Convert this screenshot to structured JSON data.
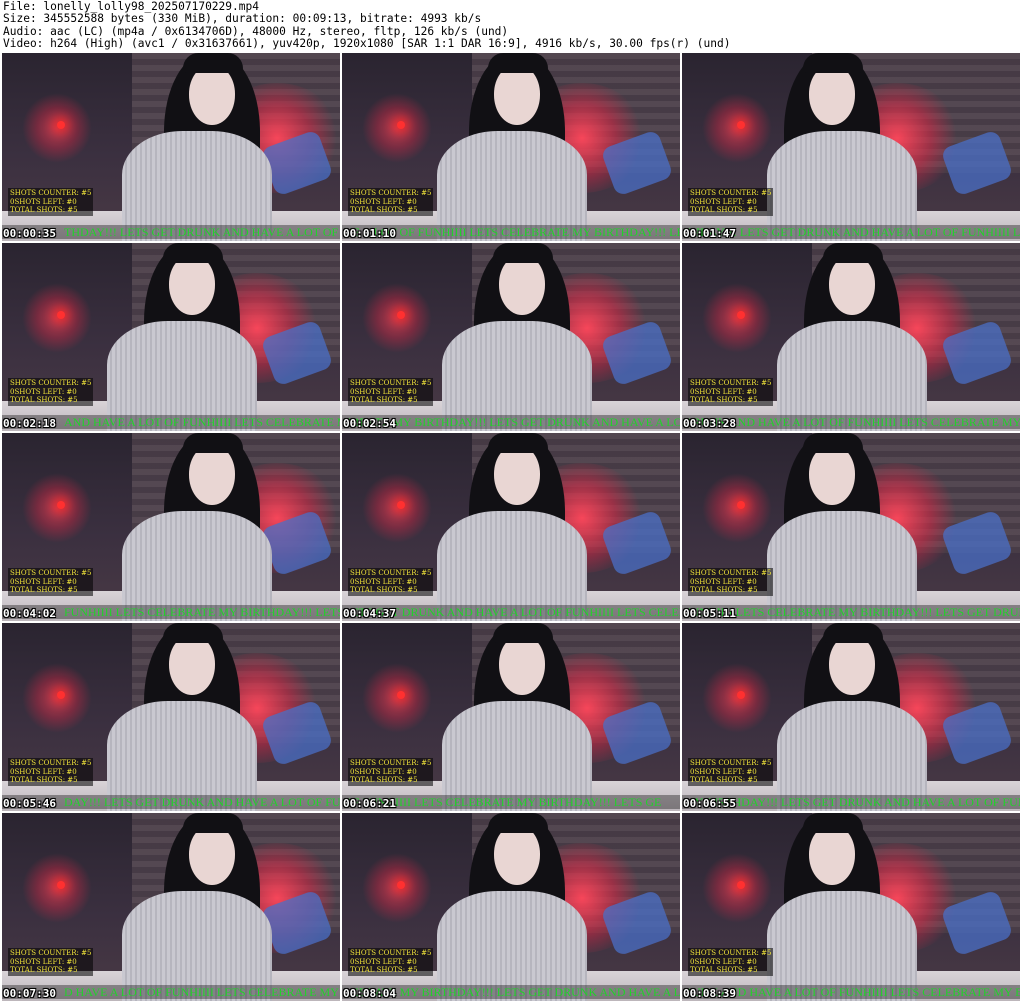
{
  "header": {
    "line1": "File: lonelly_lolly98_202507170229.mp4",
    "line2": "Size: 345552588 bytes (330 MiB), duration: 00:09:13, bitrate: 4993 kb/s",
    "line3": "Audio: aac (LC) (mp4a / 0x6134706D), 48000 Hz, stereo, fltp, 126 kb/s (und)",
    "line4": "Video: h264 (High) (avc1 / 0x31637661), yuv420p, 1920x1080 [SAR 1:1 DAR 16:9], 4916 kb/s, 30.00 fps(r) (und)"
  },
  "overlay": {
    "shots_counter": "SHOTS COUNTER: #5",
    "shots_left": "0SHOTS LEFT: #0",
    "total_shots": "TOTAL SHOTS: #5"
  },
  "thumbnails": [
    {
      "timestamp": "00:00:35",
      "ticker": "THDAY!!! LETS GET DRUNK AND HAVE A LOT OF FUNHIIII"
    },
    {
      "timestamp": "00:01:10",
      "ticker": "VE A LOT OF FUNHIIII LETS CELEBRATE MY BIRTHDAY!!! LETS"
    },
    {
      "timestamp": "00:01:47",
      "ticker": "THDAY!!! LETS GET DRUNK AND HAVE A LOT OF FUNHIIII LETS"
    },
    {
      "timestamp": "00:02:18",
      "ticker": "AND HAVE A LOT OF FUNHIIII LETS CELEBRATE MY BIRTH"
    },
    {
      "timestamp": "00:02:54",
      "ticker": "EBRATE MY BIRTHDAY!!! LETS GET DRUNK AND HAVE A LO"
    },
    {
      "timestamp": "00:03:28",
      "ticker": "DRUNK AND HAVE A LOT OF FUNHIIII LETS CELEBRATE MY"
    },
    {
      "timestamp": "00:04:02",
      "ticker": "FUNHIIII LETS CELEBRATE MY BIRTHDAY!!! LETS GET DRUNK"
    },
    {
      "timestamp": "00:04:37",
      "ticker": "LETS GET DRUNK AND HAVE A LOT OF FUNHIIII LETS CELEBRA"
    },
    {
      "timestamp": "00:05:11",
      "ticker": "FUNHIIII LETS CELEBRATE MY BIRTHDAY!!! LETS GET DRUNK"
    },
    {
      "timestamp": "00:05:46",
      "ticker": "DAY!!! LETS GET DRUNK AND HAVE A LOT OF FUNHIIII LETS"
    },
    {
      "timestamp": "00:06:21",
      "ticker": "OF FUNHIIII LETS CELEBRATE MY BIRTHDAY!!! LETS GE"
    },
    {
      "timestamp": "00:06:55",
      "ticker": "MY BIRTHDAY!!! LETS GET DRUNK AND HAVE A LOT OF FUNHIIII"
    },
    {
      "timestamp": "00:07:30",
      "ticker": "D HAVE A LOT OF FUNHIIII LETS CELEBRATE MY BIRTHDAY"
    },
    {
      "timestamp": "00:08:04",
      "ticker": "LEBRATE MY BIRTHDAY!!! LETS GET DRUNK AND HAVE A LOT"
    },
    {
      "timestamp": "00:08:39",
      "ticker": "RUNK AND HAVE A LOT OF FUNHIIII LETS CELEBRATE MY BIRTH"
    }
  ]
}
